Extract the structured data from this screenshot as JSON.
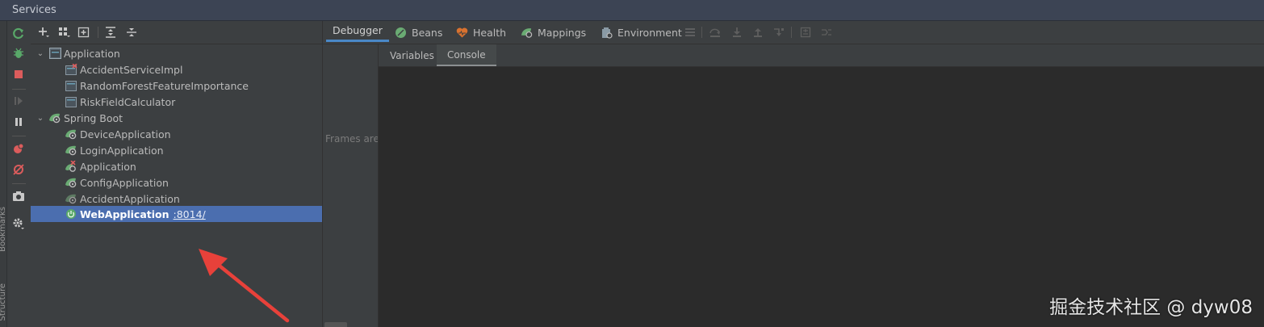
{
  "window": {
    "title": "Services"
  },
  "side_labels": {
    "bookmarks": "Bookmarks",
    "structure": "Structure"
  },
  "left_toolbar": {
    "icons": [
      "rerun-icon",
      "debug-icon",
      "stop-icon",
      "resume-icon",
      "pause-icon",
      "view-breakpoints-icon",
      "mute-breakpoints-icon",
      "camera-icon",
      "settings-icon"
    ]
  },
  "tree_toolbar": {
    "icons": [
      "add-icon",
      "group-icon",
      "new-service-icon",
      "expand-all-icon",
      "collapse-all-icon"
    ]
  },
  "tree": {
    "groups": [
      {
        "label": "Application",
        "items": [
          {
            "label": "AccidentServiceImpl"
          },
          {
            "label": "RandomForestFeatureImportance"
          },
          {
            "label": "RiskFieldCalculator"
          }
        ]
      },
      {
        "label": "Spring Boot",
        "items": [
          {
            "label": "DeviceApplication"
          },
          {
            "label": "LoginApplication"
          },
          {
            "label": "Application"
          },
          {
            "label": "ConfigApplication"
          },
          {
            "label": "AccidentApplication"
          },
          {
            "label": "WebApplication",
            "port": ":8014/"
          }
        ]
      }
    ]
  },
  "top_tabs": {
    "debugger": "Debugger",
    "beans": "Beans",
    "health": "Health",
    "mappings": "Mappings",
    "environment": "Environment"
  },
  "frames": {
    "text": "Frames are"
  },
  "sub_tabs": {
    "variables": "Variables",
    "console": "Console"
  },
  "watermark": "掘金技术社区 @ dyw08",
  "colors": {
    "selection": "#4b6eaf",
    "spring_green": "#6aab73",
    "run_green": "#59a869",
    "stop_red": "#db5c5c",
    "annotation_arrow": "#e8413a"
  }
}
